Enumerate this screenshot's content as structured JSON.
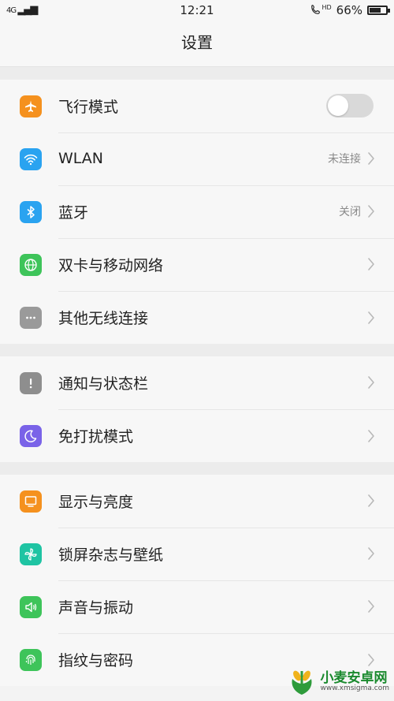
{
  "status": {
    "signal_text": "4G",
    "time": "12:21",
    "hd": "HD",
    "battery": "66%"
  },
  "header": {
    "title": "设置"
  },
  "groups": [
    {
      "items": [
        {
          "label": "飞行模式",
          "icon": "airplane-icon",
          "color": "#f5911e",
          "type": "toggle",
          "on": false
        },
        {
          "label": "WLAN",
          "icon": "wifi-icon",
          "color": "#2aa3f0",
          "value": "未连接"
        },
        {
          "label": "蓝牙",
          "icon": "bluetooth-icon",
          "color": "#2aa3f0",
          "value": "关闭"
        },
        {
          "label": "双卡与移动网络",
          "icon": "globe-icon",
          "color": "#3ec45a"
        },
        {
          "label": "其他无线连接",
          "icon": "more-icon",
          "color": "#9a9a9a"
        }
      ]
    },
    {
      "items": [
        {
          "label": "通知与状态栏",
          "icon": "notification-icon",
          "color": "#8e8e8e"
        },
        {
          "label": "免打扰模式",
          "icon": "moon-icon",
          "color": "#7a63e8"
        }
      ]
    },
    {
      "items": [
        {
          "label": "显示与亮度",
          "icon": "display-icon",
          "color": "#f5911e"
        },
        {
          "label": "锁屏杂志与壁纸",
          "icon": "pinwheel-icon",
          "color": "#1fc4a3"
        },
        {
          "label": "声音与振动",
          "icon": "speaker-icon",
          "color": "#3ec45a"
        },
        {
          "label": "指纹与密码",
          "icon": "fingerprint-icon",
          "color": "#3ec45a"
        }
      ]
    }
  ],
  "watermark": {
    "title": "小麦安卓网",
    "url": "www.xmsigma.com"
  },
  "colors": {
    "chevron": "#b8b8b8",
    "value_text": "#8a8a8a"
  }
}
